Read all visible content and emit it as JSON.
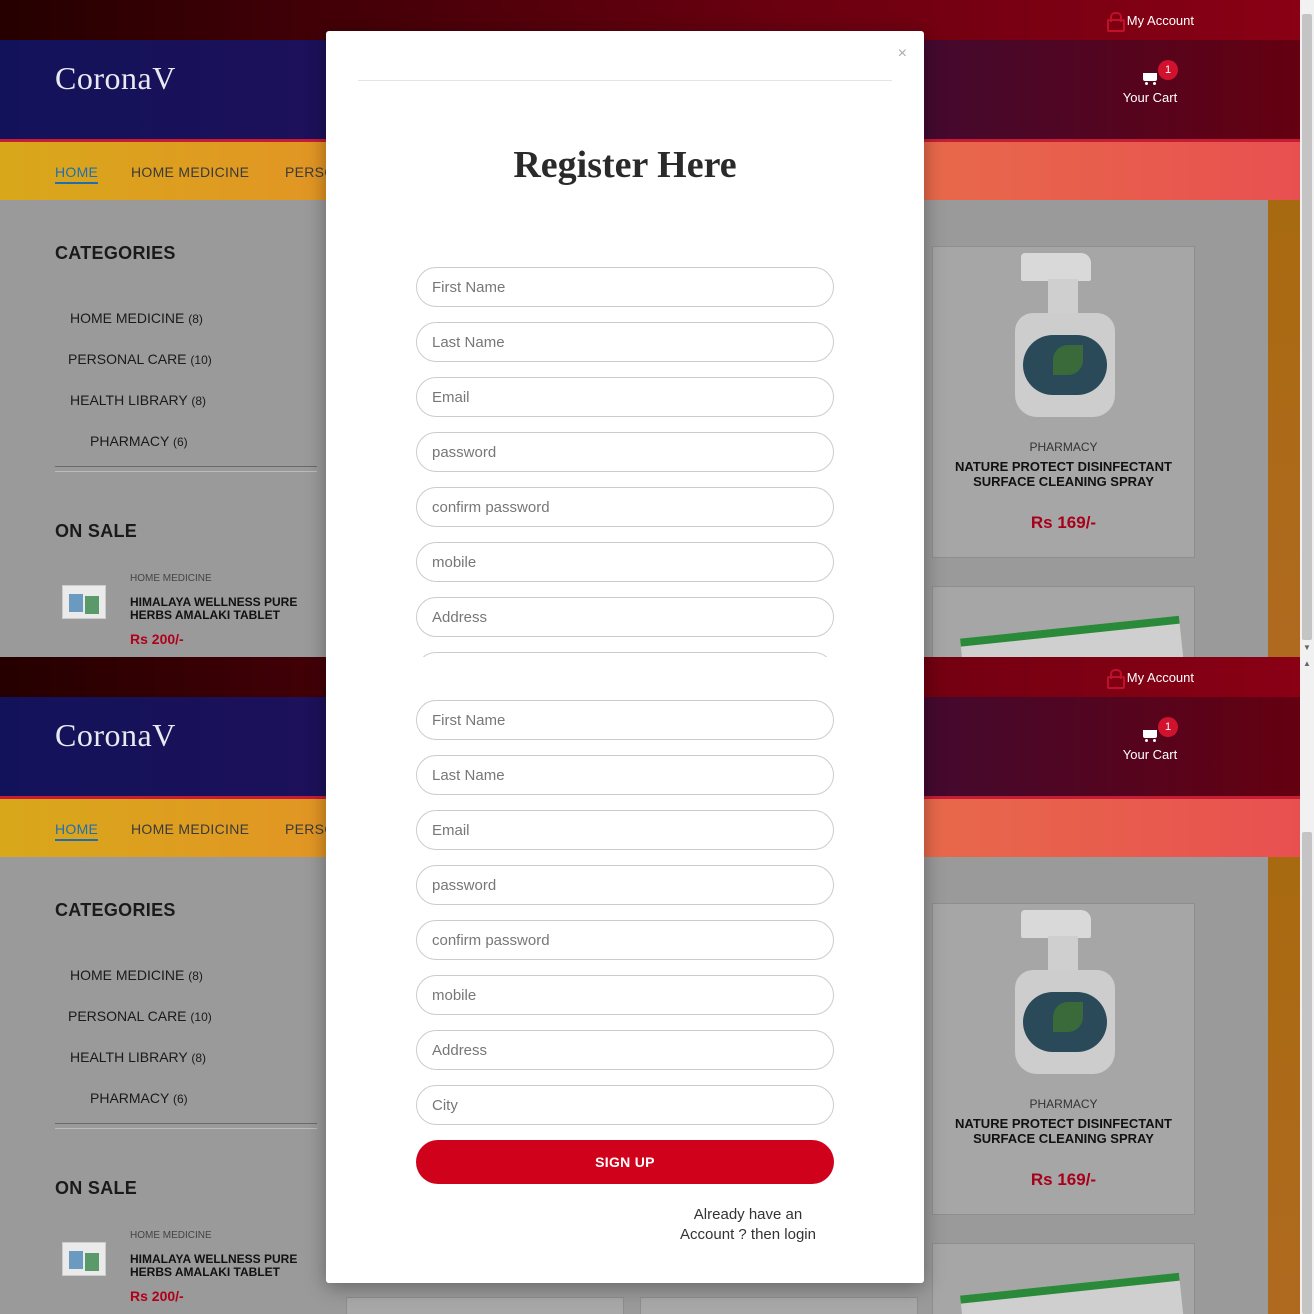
{
  "site": {
    "logo": "CoronaV",
    "account_label": "My Account",
    "cart_label": "Your Cart",
    "cart_count": "1",
    "nav": [
      "HOME",
      "HOME MEDICINE",
      "PERSO"
    ],
    "categories_title": "CATEGORIES",
    "categories": [
      {
        "name": "HOME MEDICINE",
        "count": "(8)"
      },
      {
        "name": "PERSONAL CARE",
        "count": "(10)"
      },
      {
        "name": "HEALTH LIBRARY",
        "count": "(8)"
      },
      {
        "name": "PHARMACY",
        "count": "(6)"
      }
    ],
    "on_sale_title": "ON SALE",
    "sale_item": {
      "category": "HOME MEDICINE",
      "name": "HIMALAYA WELLNESS PURE HERBS AMALAKI TABLET",
      "price": "Rs 200/-"
    },
    "product": {
      "category": "PHARMACY",
      "name": "NATURE PROTECT DISINFECTANT SURFACE CLEANING SPRAY",
      "price": "Rs 169/-"
    }
  },
  "modal": {
    "close": "×",
    "title": "Register Here",
    "fields": {
      "first_name": "First Name",
      "last_name": "Last Name",
      "email": "Email",
      "password": "password",
      "confirm_password": "confirm password",
      "mobile": "mobile",
      "address": "Address",
      "city": "City"
    },
    "signup_label": "SIGN UP",
    "login_text": "Already have an Account ? then login"
  },
  "colors": {
    "accent": "#d0021b",
    "nav_active": "#1f6fb0"
  }
}
